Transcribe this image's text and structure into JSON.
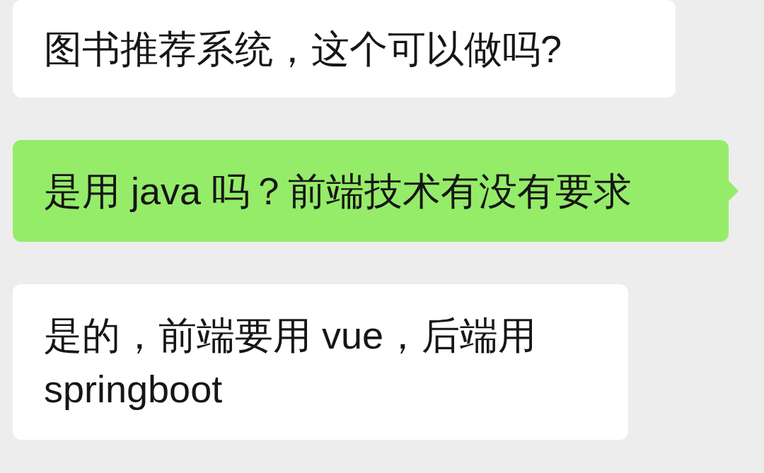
{
  "messages": [
    {
      "kind": "received",
      "text": "图书推荐系统，这个可以做吗?"
    },
    {
      "kind": "sent",
      "text": "是用 java 吗？前端技术有没有要求"
    },
    {
      "kind": "received",
      "text": "是的，前端要用 vue，后端用 springboot"
    }
  ]
}
